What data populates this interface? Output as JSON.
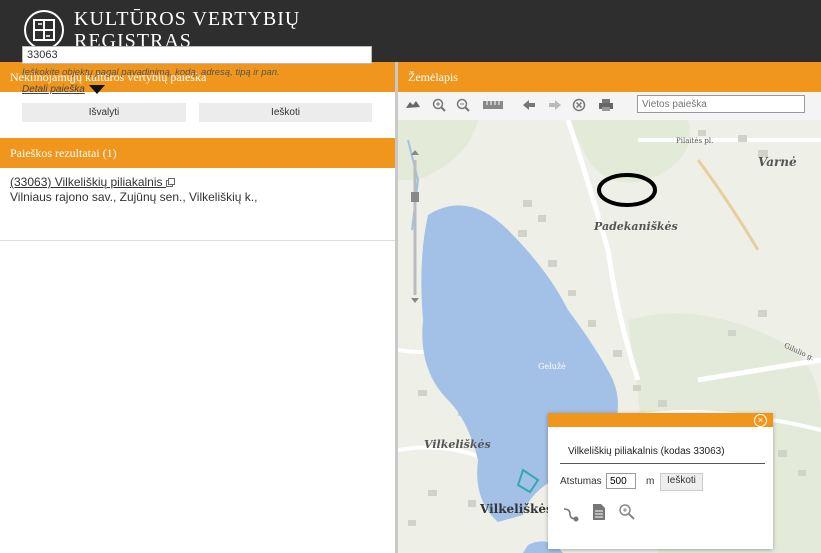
{
  "header": {
    "title_line1": "KULTŪROS VERTYBIŲ",
    "title_line2": "REGISTRAS"
  },
  "search_panel": {
    "title": "Nekilnojamųjų kultūros vertybių paieška",
    "input_value": "33063",
    "hint": "Ieškokite objektų pagal pavadinimą, kodą, adresą, tipą ir pan.",
    "detail_link": "Detali paieška",
    "clear_button": "Išvalyti",
    "search_button": "Ieškoti"
  },
  "results_panel": {
    "title": "Paieškos rezultatai (1)",
    "item_link": "(33063) Vilkeliškių piliakalnis",
    "item_address": "Vilniaus rajono sav., Zujūnų sen., Vilkeliškių k.,"
  },
  "map_panel": {
    "title": "Žemėlapis",
    "place_search_placeholder": "Vietos paieška",
    "labels": {
      "varne": "Varnė",
      "padekaniskes": "Padekaniškės",
      "vilkeliskes_left": "Vilkeliškės",
      "vilkeliskes_bottom": "Vilkeliškės",
      "lake": "Gelužė",
      "road_pilaites": "Pilaitės pl.",
      "road_gilulio": "Gilulio g."
    }
  },
  "popup": {
    "title": "Vilkeliškių piliakalnis (kodas 33063)",
    "distance_label": "Atstumas",
    "distance_value": "500",
    "unit": "m",
    "search_button": "Ieškoti"
  },
  "colors": {
    "accent": "#f0961d",
    "header": "#2e2e2e",
    "lake": "#a3c0e6"
  }
}
